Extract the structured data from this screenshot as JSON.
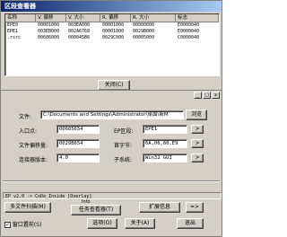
{
  "section_window": {
    "title": "区段查看器",
    "columns": [
      "名称",
      "V. 偏移",
      "V. 大小",
      "R. 偏移",
      "R. 大小",
      "标志"
    ],
    "rows": [
      [
        "EPE0",
        "00001000",
        "003EA000",
        "00001000",
        "00000000",
        "E0000040"
      ],
      [
        "EPE1",
        "003EB000",
        "002A6768",
        "00001000",
        "0029B000",
        "E0000040"
      ],
      [
        ".rsrc",
        "00686000",
        "000045B6",
        "0029C000",
        "00005000",
        "C0000040"
      ]
    ],
    "close_button": "关闭(C)"
  },
  "main_window": {
    "toolbar": [
      "_",
      "□",
      "x"
    ],
    "file_label": "文件:",
    "file_path": "C:\\Documents and Settings\\Administrator\\桌面\\新M",
    "browse_button": "浏览",
    "entry_label": "入口点:",
    "entry_value": "00685654",
    "section_label": "EP区段:",
    "section_value": "EPE1",
    "offset_label": "文件偏移量:",
    "offset_value": "0029B654",
    "firstbyte_label": "首字节:",
    "firstbyte_value": "6A,06,60,E9",
    "linker_label": "连接器版本:",
    "linker_value": "4.0",
    "subsystem_label": "子系统:",
    "subsystem_value": "Win32 GUI",
    "status_text": "EP v2.0 -> CoDe_Inside [Overlay]",
    "buttons": {
      "multi_scan": "多文件扫描(M)",
      "info": "Info",
      "task_viewer": "任务查看器(T)",
      "plugin_info": "扩展信息",
      "more": "=>",
      "options": "选项(O)",
      "about": "关于(A)",
      "exit": "退出",
      "arrow": ">"
    },
    "stay_on_top_label": "窗口置前(S)",
    "stay_on_top_checked": true
  },
  "colors": {
    "title_gradient_start": "#0a246a",
    "title_gradient_end": "#a6caf0",
    "dialog_face": "#d4d0c8"
  }
}
